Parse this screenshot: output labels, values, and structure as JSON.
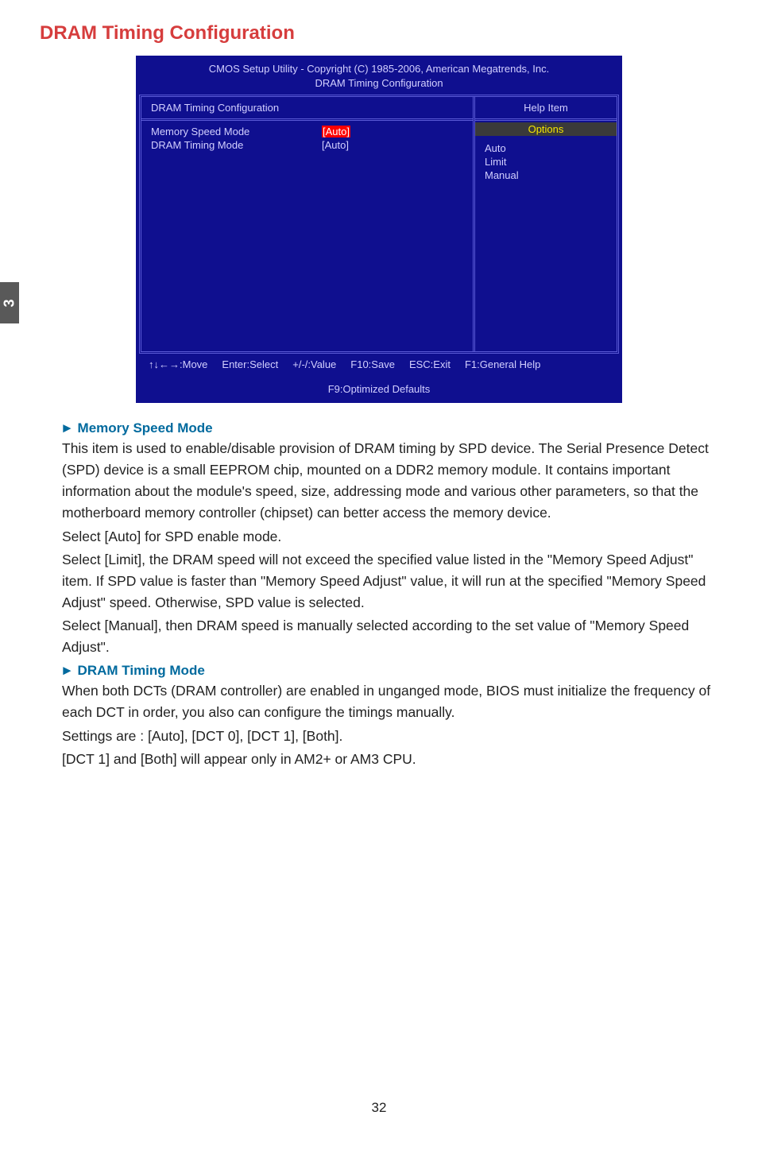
{
  "page": {
    "tabNumber": "3",
    "sectionTitle": "DRAM Timing Configuration",
    "pageNumber": "32"
  },
  "bios": {
    "headerLine1": "CMOS Setup Utility - Copyright (C) 1985-2006, American Megatrends, Inc.",
    "headerLine2": "DRAM Timing Configuration",
    "leftTitle": "DRAM Timing Configuration",
    "rightTitle": "Help Item",
    "fields": [
      {
        "label": "Memory Speed Mode",
        "value": "[Auto]",
        "selected": true
      },
      {
        "label": "DRAM Timing Mode",
        "value": "[Auto]",
        "selected": false
      }
    ],
    "optionsHeader": "Options",
    "options": [
      "Auto",
      "Limit",
      "Manual"
    ],
    "footer": {
      "move": "↑↓←→:Move",
      "enter": "Enter:Select",
      "value": "+/-/:Value",
      "f10": "F10:Save",
      "esc": "ESC:Exit",
      "f1": "F1:General Help",
      "f9": "F9:Optimized Defaults"
    }
  },
  "items": {
    "memorySpeed": {
      "title": "► Memory Speed Mode",
      "p1": "This item is used to enable/disable provision of DRAM timing by SPD device. The Serial Presence Detect (SPD) device is a small EEPROM chip, mounted on a DDR2 memory module. It contains important information about the module's speed, size, addressing mode and various other parameters, so that the motherboard memory controller (chipset) can better access the memory device.",
      "p2": "Select [Auto] for SPD enable mode.",
      "p3": "Select [Limit], the DRAM speed will not exceed the specified value listed in the \"Memory Speed Adjust\" item. If SPD value is faster than \"Memory Speed Adjust\" value, it will run at the specified \"Memory Speed Adjust\" speed. Otherwise, SPD value is selected.",
      "p4": "Select [Manual], then DRAM speed is manually selected according to the set value of \"Memory Speed Adjust\"."
    },
    "dramTiming": {
      "title": "► DRAM Timing Mode",
      "p1": "When both DCTs (DRAM controller) are enabled in unganged mode, BIOS must initialize the frequency of each DCT in order, you also can configure the timings manually.",
      "p2": "Settings are : [Auto], [DCT 0], [DCT 1], [Both].",
      "p3": "[DCT 1] and [Both] will appear only in AM2+ or AM3 CPU."
    }
  }
}
